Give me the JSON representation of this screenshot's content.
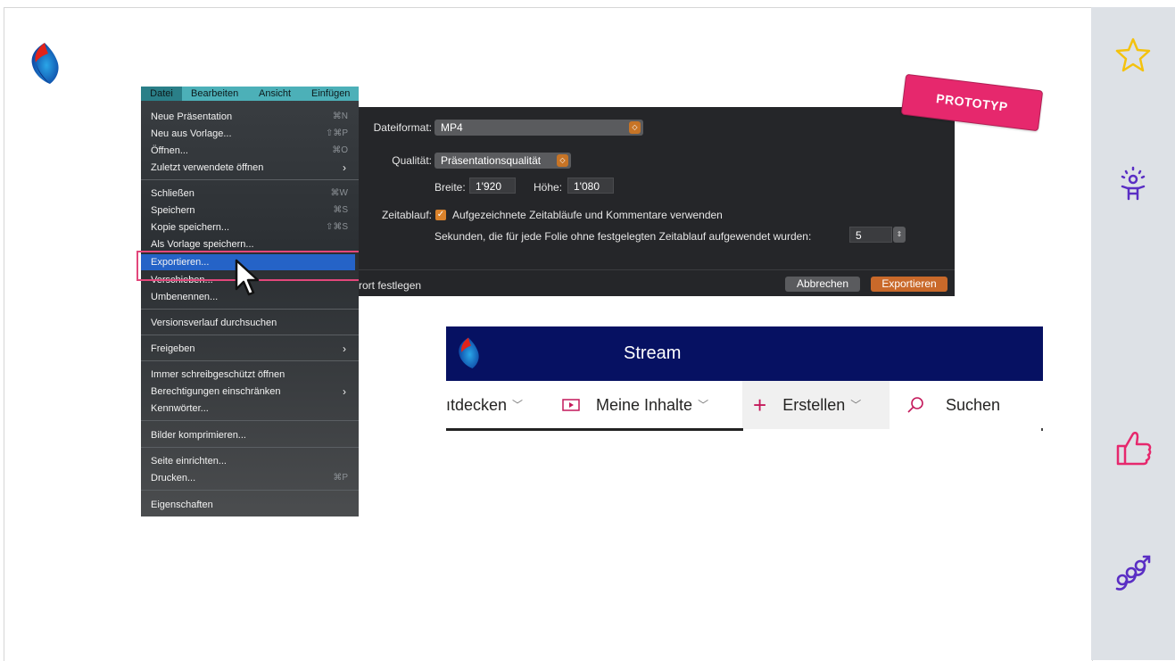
{
  "menu": {
    "bar": [
      "Datei",
      "Bearbeiten",
      "Ansicht",
      "Einfügen"
    ],
    "items": [
      {
        "label": "Neue Präsentation",
        "shortcut": "⌘N"
      },
      {
        "label": "Neu aus Vorlage...",
        "shortcut": "⇧⌘P"
      },
      {
        "label": "Öffnen...",
        "shortcut": "⌘O"
      },
      {
        "label": "Zuletzt verwendete öffnen",
        "shortcut": "›"
      },
      {
        "label": "Schließen",
        "shortcut": "⌘W"
      },
      {
        "label": "Speichern",
        "shortcut": "⌘S"
      },
      {
        "label": "Kopie speichern...",
        "shortcut": "⇧⌘S"
      },
      {
        "label": "Als Vorlage speichern...",
        "shortcut": ""
      },
      {
        "label": "Exportieren...",
        "shortcut": ""
      },
      {
        "label": "Verschieben...",
        "shortcut": ""
      },
      {
        "label": "Umbenennen...",
        "shortcut": ""
      },
      {
        "label": "Versionsverlauf durchsuchen",
        "shortcut": ""
      },
      {
        "label": "Freigeben",
        "shortcut": "›"
      },
      {
        "label": "Immer schreibgeschützt öffnen",
        "shortcut": ""
      },
      {
        "label": "Berechtigungen einschränken",
        "shortcut": "›"
      },
      {
        "label": "Kennwörter...",
        "shortcut": ""
      },
      {
        "label": "Bilder komprimieren...",
        "shortcut": ""
      },
      {
        "label": "Seite einrichten...",
        "shortcut": ""
      },
      {
        "label": "Drucken...",
        "shortcut": "⌘P"
      },
      {
        "label": "Eigenschaften",
        "shortcut": ""
      }
    ]
  },
  "dialog": {
    "format_label": "Dateiformat:",
    "format_value": "MP4",
    "quality_label": "Qualität:",
    "quality_value": "Präsentationsqualität",
    "width_label": "Breite:",
    "width_value": "1'920",
    "height_label": "Höhe:",
    "height_value": "1'080",
    "timing_label": "Zeitablauf:",
    "timing_checkbox": "Aufgezeichnete Zeitabläufe und Kommentare verwenden",
    "seconds_label": "Sekunden, die für jede Folie ohne festgelegten Zeitablauf aufgewendet wurden:",
    "seconds_value": "5",
    "footer_left": "rort festlegen",
    "cancel": "Abbrechen",
    "export": "Exportieren"
  },
  "prototype_label": "PROTOTYP",
  "stream": {
    "title": "Stream",
    "nav": {
      "discover": "ıtdecken",
      "my_content": "Meine Inhalte",
      "create": "Erstellen",
      "search": "Suchen"
    }
  },
  "colors": {
    "accent_orange": "#d9822b",
    "stream_navy": "#061162",
    "prototype_pink": "#e6286d",
    "menu_teal": "#4cb0b8"
  }
}
